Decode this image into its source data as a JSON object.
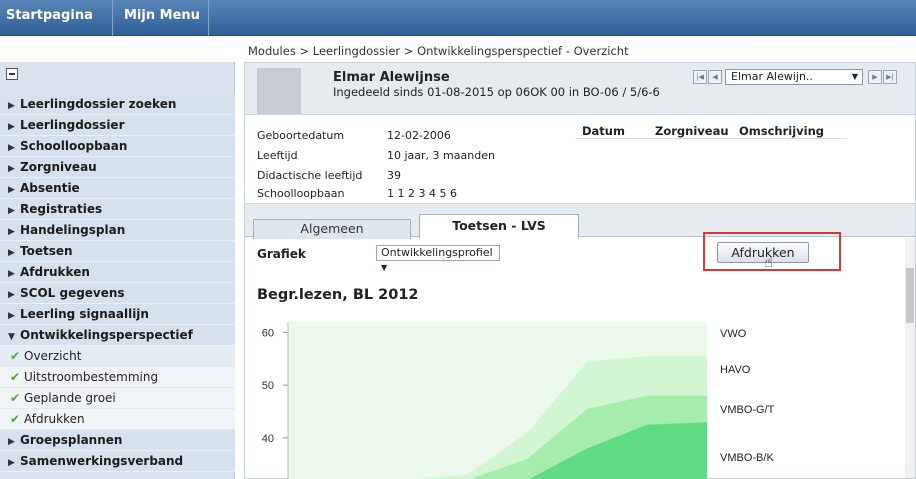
{
  "topbar": {
    "tabs": [
      "Startpagina",
      "Mijn Menu"
    ]
  },
  "breadcrumb": "Modules > Leerlingdossier > Ontwikkelingsperspectief - Overzicht",
  "sidebar": {
    "items": [
      {
        "label": "Leerlingdossier zoeken",
        "expanded": false
      },
      {
        "label": "Leerlingdossier",
        "expanded": false
      },
      {
        "label": "Schoolloopbaan",
        "expanded": false
      },
      {
        "label": "Zorgniveau",
        "expanded": false
      },
      {
        "label": "Absentie",
        "expanded": false
      },
      {
        "label": "Registraties",
        "expanded": false
      },
      {
        "label": "Handelingsplan",
        "expanded": false
      },
      {
        "label": "Toetsen",
        "expanded": false
      },
      {
        "label": "Afdrukken",
        "expanded": false
      },
      {
        "label": "SCOL gegevens",
        "expanded": false
      },
      {
        "label": "Leerling signaallijn",
        "expanded": false
      },
      {
        "label": "Ontwikkelingsperspectief",
        "expanded": true
      },
      {
        "label": "Groepsplannen",
        "expanded": false
      },
      {
        "label": "Samenwerkingsverband",
        "expanded": false
      }
    ],
    "subitems": [
      "Overzicht",
      "Uitstroombestemming",
      "Geplande groei",
      "Afdrukken"
    ],
    "active_subitem": "Overzicht"
  },
  "student": {
    "name": "Elmar Alewijnse",
    "subtitle": "Ingedeeld sinds 01-08-2015 op 06OK 00 in BO-06 / 5/6-6",
    "selector_value": "Elmar Alewijn.."
  },
  "info": {
    "rows": [
      {
        "label": "Geboortedatum",
        "value": "12-02-2006"
      },
      {
        "label": "Leeftijd",
        "value": "10 jaar, 3 maanden"
      },
      {
        "label": "Didactische leeftijd",
        "value": "39"
      },
      {
        "label": "Schoolloopbaan",
        "value": "1 1 2 3 4 5 6"
      }
    ],
    "columns": [
      "Datum",
      "Zorgniveau",
      "Omschrijving"
    ]
  },
  "tabs": {
    "algemeen": "Algemeen",
    "toetsen": "Toetsen - LVS",
    "active": "Toetsen - LVS"
  },
  "grafiek": {
    "label": "Grafiek",
    "selected": "Ontwikkelingsprofiel"
  },
  "print_button": "Afdrukken",
  "chart_data": {
    "type": "area",
    "title": "Begr.lezen, BL 2012",
    "xlabel": "",
    "ylabel": "",
    "yticks": [
      60,
      50,
      40
    ],
    "ylim": [
      32,
      62
    ],
    "x": [
      0,
      1,
      2,
      3,
      4,
      5,
      6,
      7
    ],
    "grid": false,
    "level_labels": [
      "VWO",
      "HAVO",
      "VMBO-G/T",
      "VMBO-B/K"
    ],
    "series": [
      {
        "values": [
          30,
          30,
          31,
          33,
          41,
          54.5,
          55.5,
          55.5
        ],
        "color": "#d2f5d2"
      },
      {
        "values": [
          30,
          30,
          30,
          31,
          36,
          45.5,
          48,
          48
        ],
        "color": "#a6ecad"
      },
      {
        "values": [
          30,
          30,
          30,
          30,
          32,
          38,
          42.5,
          43
        ],
        "color": "#5fdb83"
      }
    ],
    "colors": {
      "band_light": "#d2f5d2",
      "band_mid": "#a6ecad",
      "band_dark": "#5fdb83",
      "background": "#eaf9ea"
    }
  }
}
